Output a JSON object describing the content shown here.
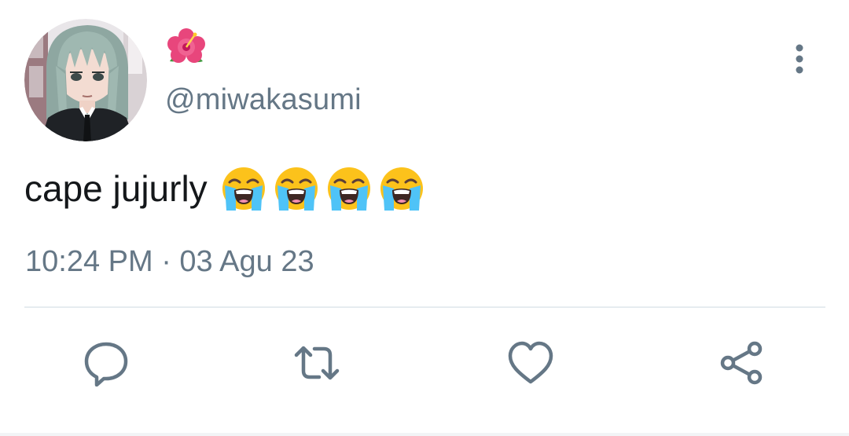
{
  "tweet": {
    "display_name_emoji": "hibiscus-emoji",
    "handle": "@miwakasumi",
    "text": "cape jujurly",
    "text_emojis": [
      "loudly-crying-face-emoji",
      "loudly-crying-face-emoji",
      "loudly-crying-face-emoji",
      "loudly-crying-face-emoji"
    ],
    "timestamp": "10:24 PM · 03 Agu 23"
  },
  "actions": {
    "reply_icon": "reply-icon",
    "retweet_icon": "retweet-icon",
    "like_icon": "heart-icon",
    "share_icon": "share-icon",
    "more_icon": "more-vertical-icon"
  },
  "colors": {
    "secondary_text": "#657786",
    "icon_color": "#657786",
    "divider": "#e6ecf0",
    "primary_text": "#14171a"
  }
}
